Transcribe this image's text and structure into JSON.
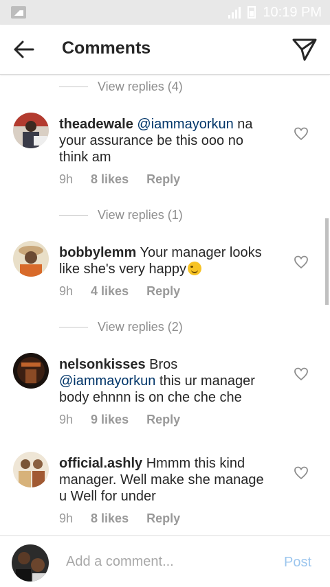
{
  "status_bar": {
    "time": "10:19 PM"
  },
  "header": {
    "title": "Comments"
  },
  "comments": [
    {
      "username": "theadewale",
      "mention": "@iammayorkun",
      "text": " na your assurance be this ooo no think am",
      "time": "9h",
      "likes": "8 likes",
      "reply": "Reply",
      "view_replies_above": "View replies (4)"
    },
    {
      "username": "bobbylemm",
      "mention": "",
      "text": " Your manager looks like she's very happy",
      "emoji": "winking-face",
      "time": "9h",
      "likes": "4 likes",
      "reply": "Reply",
      "view_replies_above": "View replies (1)"
    },
    {
      "username": "nelsonkisses",
      "prefix": " Bros ",
      "mention": "@iammayorkun",
      "text": " this ur manager body ehnnn is on che che che",
      "time": "9h",
      "likes": "9 likes",
      "reply": "Reply",
      "view_replies_above": "View replies (2)"
    },
    {
      "username": "official.ashly",
      "mention": "",
      "text": " Hmmm this kind manager. Well make she manage u Well for under",
      "time": "9h",
      "likes": "8 likes",
      "reply": "Reply"
    }
  ],
  "composer": {
    "placeholder": "Add a comment...",
    "post_label": "Post"
  },
  "colors": {
    "mention": "#003569",
    "post_disabled": "#9cc6ee",
    "meta": "#999999"
  }
}
